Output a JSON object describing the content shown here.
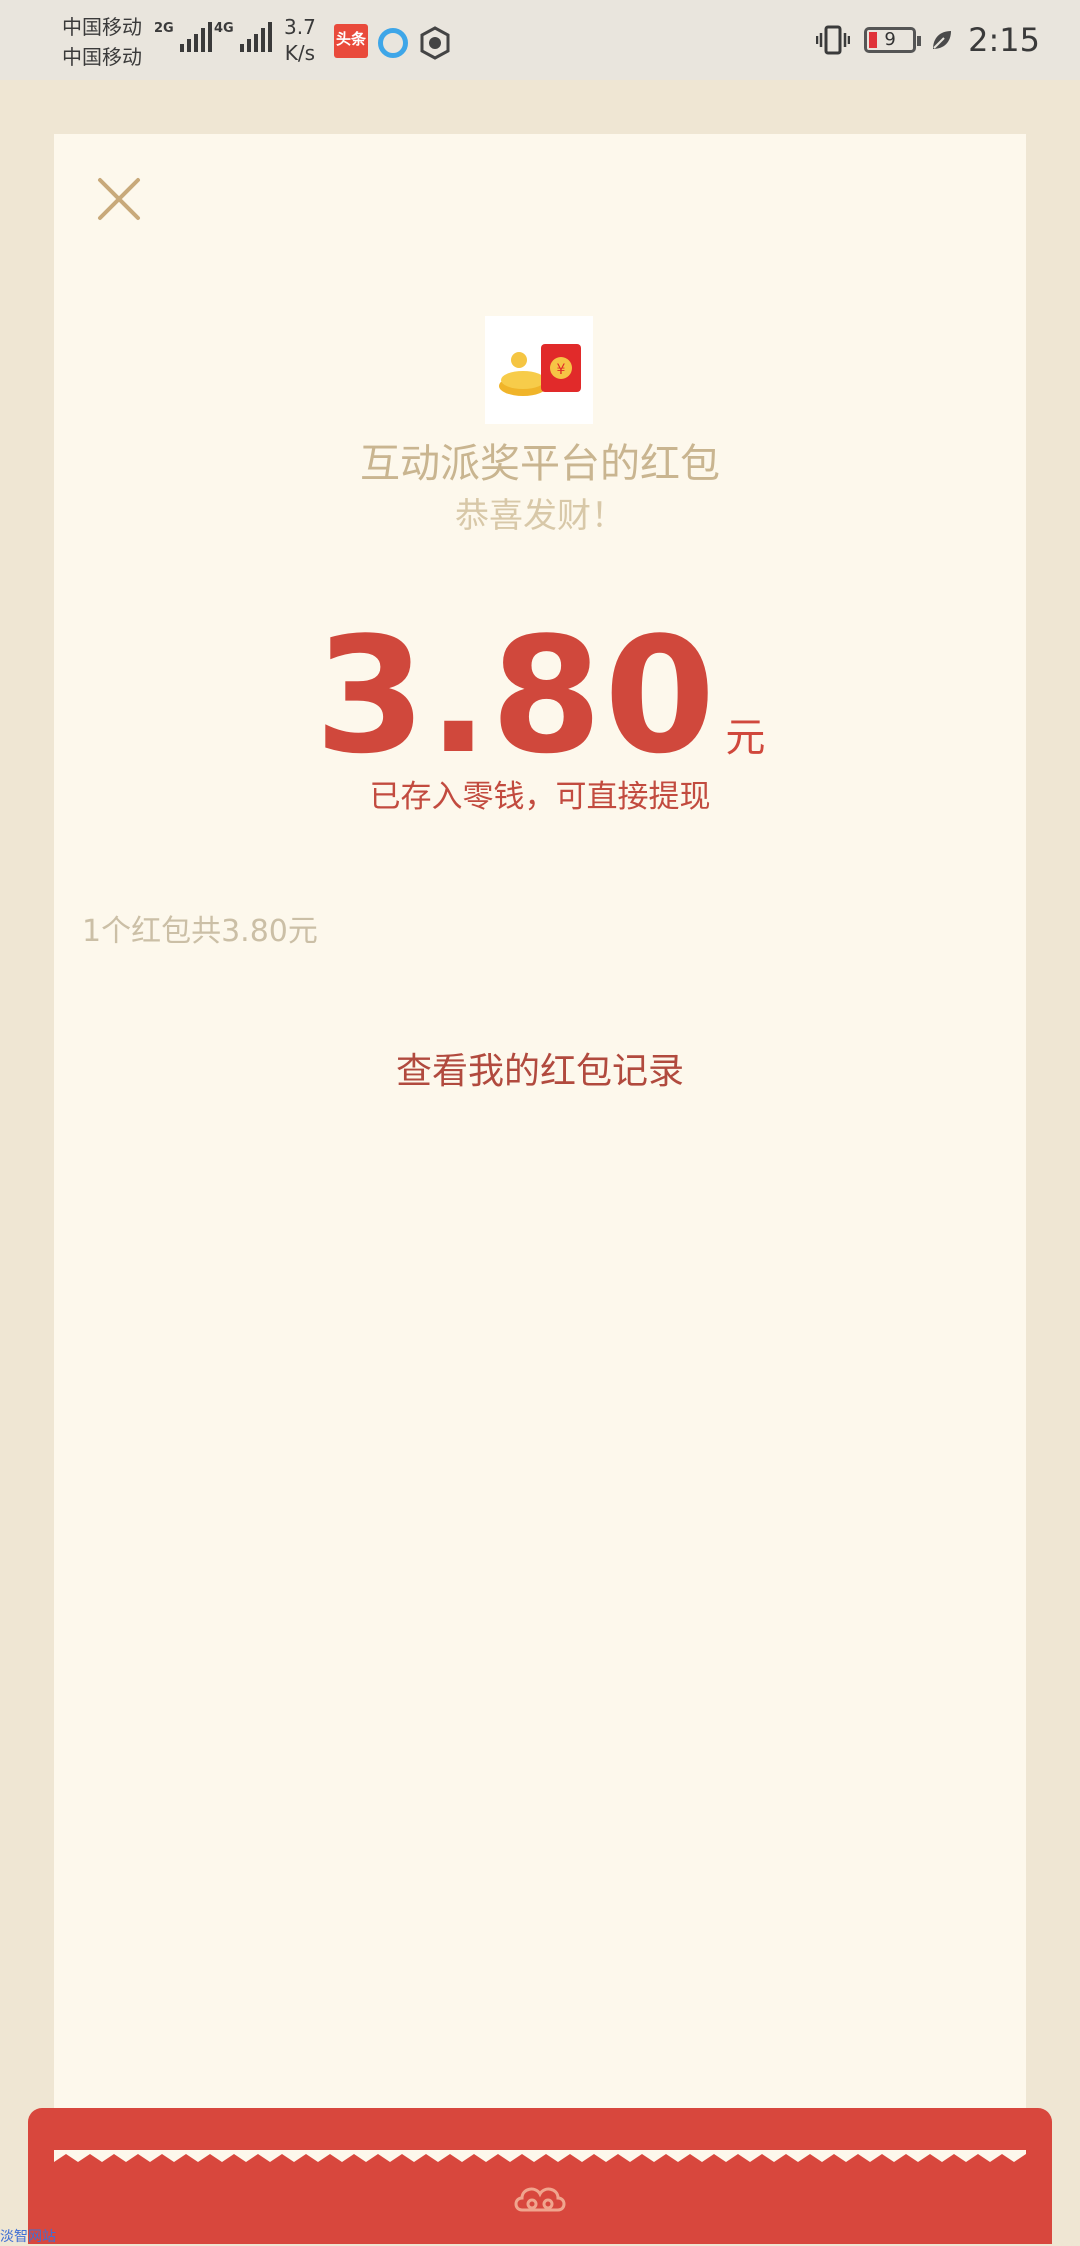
{
  "status_bar": {
    "carrier_1": "中国移动",
    "carrier_2": "中国移动",
    "network_1": "2G",
    "network_2": "4G",
    "speed_value": "3.7",
    "speed_unit": "K/s",
    "news_app_label": "头条",
    "battery_level": "9",
    "time": "2:15"
  },
  "card": {
    "sender": "互动派奖平台的红包",
    "greeting": "恭喜发财！",
    "amount": "3.80",
    "unit": "元",
    "saved_note": "已存入零钱，可直接提现",
    "summary": "1个红包共3.80元",
    "records_link": "查看我的红包记录"
  },
  "colors": {
    "accent_red": "#d0483c",
    "card_bg": "#fdf8ec",
    "page_bg": "#efe6d3"
  },
  "watermark": "淡智网站"
}
